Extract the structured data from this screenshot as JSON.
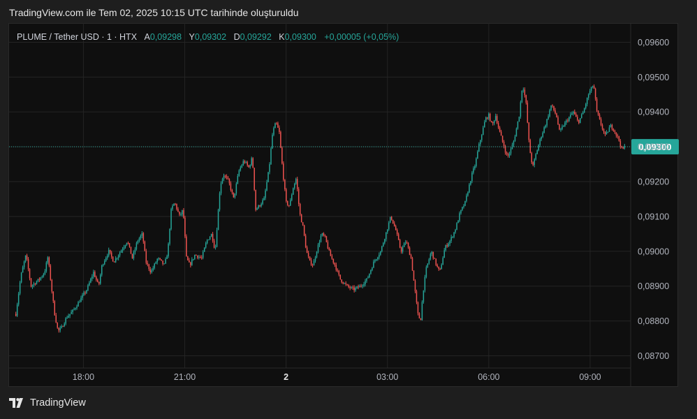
{
  "header": {
    "title": "TradingView.com ile Tem 02, 2025 10:15 UTC tarihinde oluşturuldu"
  },
  "legend": {
    "symbol": "PLUME / Tether USD · 1 · HTX",
    "open_label": "A",
    "open": "0,09298",
    "high_label": "Y",
    "high": "0,09302",
    "low_label": "D",
    "low": "0,09292",
    "close_label": "K",
    "close": "0,09300",
    "change": "+0,00005 (+0,05%)"
  },
  "footer": {
    "brand": "TradingView"
  },
  "colors": {
    "up": "#26a69a",
    "down": "#ef5350",
    "grid": "#242424",
    "axis_text": "#b2b5be",
    "price_tag": "#26a69a",
    "background": "#0f0f0f"
  },
  "chart_data": {
    "type": "candlestick",
    "interval": "1 minute",
    "symbol": "PLUME / Tether USD",
    "exchange": "HTX",
    "y_ticks": [
      "0,09600",
      "0,09500",
      "0,09400",
      "0,09300",
      "0,09200",
      "0,09100",
      "0,09000",
      "0,08900",
      "0,08800",
      "0,08700"
    ],
    "y_tick_values": [
      0.096,
      0.095,
      0.094,
      0.093,
      0.092,
      0.091,
      0.09,
      0.089,
      0.088,
      0.087
    ],
    "x_ticks": [
      "18:00",
      "21:00",
      "2",
      "03:00",
      "06:00",
      "09:00"
    ],
    "x_tick_hours": [
      2.0,
      5.0,
      8.0,
      11.0,
      14.0,
      17.0
    ],
    "ylim": [
      0.08665,
      0.09655
    ],
    "xlim_hours": [
      -0.2,
      18.2
    ],
    "last_price": "0,09300",
    "last_price_value": 0.093,
    "grid": true,
    "close_path": [
      [
        0.0,
        0.0882
      ],
      [
        0.15,
        0.0893
      ],
      [
        0.3,
        0.0899
      ],
      [
        0.45,
        0.089
      ],
      [
        0.7,
        0.0892
      ],
      [
        0.85,
        0.0894
      ],
      [
        0.95,
        0.08985
      ],
      [
        1.05,
        0.089
      ],
      [
        1.15,
        0.0882
      ],
      [
        1.25,
        0.0877
      ],
      [
        1.35,
        0.0878
      ],
      [
        1.5,
        0.0881
      ],
      [
        1.7,
        0.0883
      ],
      [
        1.9,
        0.0886
      ],
      [
        2.1,
        0.0889
      ],
      [
        2.3,
        0.0894
      ],
      [
        2.45,
        0.089
      ],
      [
        2.55,
        0.0896
      ],
      [
        2.65,
        0.0898
      ],
      [
        2.75,
        0.09
      ],
      [
        2.9,
        0.0897
      ],
      [
        3.1,
        0.09
      ],
      [
        3.3,
        0.0903
      ],
      [
        3.45,
        0.0898
      ],
      [
        3.6,
        0.0903
      ],
      [
        3.75,
        0.0905
      ],
      [
        3.85,
        0.0897
      ],
      [
        4.0,
        0.0894
      ],
      [
        4.2,
        0.0898
      ],
      [
        4.4,
        0.0896
      ],
      [
        4.5,
        0.09
      ],
      [
        4.6,
        0.0912
      ],
      [
        4.7,
        0.0914
      ],
      [
        4.85,
        0.091
      ],
      [
        4.95,
        0.0912
      ],
      [
        5.05,
        0.0898
      ],
      [
        5.15,
        0.0896
      ],
      [
        5.3,
        0.0899
      ],
      [
        5.5,
        0.0898
      ],
      [
        5.65,
        0.0903
      ],
      [
        5.8,
        0.0905
      ],
      [
        5.9,
        0.09
      ],
      [
        6.05,
        0.0919
      ],
      [
        6.15,
        0.0922
      ],
      [
        6.3,
        0.092
      ],
      [
        6.45,
        0.0915
      ],
      [
        6.6,
        0.0923
      ],
      [
        6.75,
        0.0926
      ],
      [
        6.9,
        0.0924
      ],
      [
        7.0,
        0.0927
      ],
      [
        7.1,
        0.0912
      ],
      [
        7.2,
        0.0913
      ],
      [
        7.35,
        0.0915
      ],
      [
        7.5,
        0.0924
      ],
      [
        7.6,
        0.0934
      ],
      [
        7.7,
        0.0937
      ],
      [
        7.8,
        0.0934
      ],
      [
        7.9,
        0.0923
      ],
      [
        8.0,
        0.0914
      ],
      [
        8.1,
        0.0913
      ],
      [
        8.2,
        0.0918
      ],
      [
        8.3,
        0.0921
      ],
      [
        8.4,
        0.0911
      ],
      [
        8.5,
        0.0907
      ],
      [
        8.6,
        0.09
      ],
      [
        8.7,
        0.0897
      ],
      [
        8.8,
        0.0896
      ],
      [
        8.9,
        0.09
      ],
      [
        9.05,
        0.0905
      ],
      [
        9.15,
        0.0904
      ],
      [
        9.3,
        0.0899
      ],
      [
        9.45,
        0.0896
      ],
      [
        9.6,
        0.0892
      ],
      [
        9.8,
        0.089
      ],
      [
        10.0,
        0.0889
      ],
      [
        10.2,
        0.089
      ],
      [
        10.4,
        0.0892
      ],
      [
        10.6,
        0.0897
      ],
      [
        10.8,
        0.09
      ],
      [
        10.95,
        0.0905
      ],
      [
        11.1,
        0.091
      ],
      [
        11.25,
        0.0906
      ],
      [
        11.4,
        0.09
      ],
      [
        11.55,
        0.0903
      ],
      [
        11.7,
        0.0898
      ],
      [
        11.8,
        0.089
      ],
      [
        11.9,
        0.0882
      ],
      [
        11.98,
        0.088
      ],
      [
        12.05,
        0.0888
      ],
      [
        12.15,
        0.0895
      ],
      [
        12.3,
        0.09
      ],
      [
        12.45,
        0.0896
      ],
      [
        12.55,
        0.0894
      ],
      [
        12.7,
        0.0901
      ],
      [
        12.85,
        0.0903
      ],
      [
        13.0,
        0.0906
      ],
      [
        13.15,
        0.0911
      ],
      [
        13.3,
        0.0914
      ],
      [
        13.4,
        0.0918
      ],
      [
        13.5,
        0.0922
      ],
      [
        13.6,
        0.0925
      ],
      [
        13.7,
        0.093
      ],
      [
        13.8,
        0.0934
      ],
      [
        13.9,
        0.0938
      ],
      [
        14.0,
        0.0939
      ],
      [
        14.1,
        0.0936
      ],
      [
        14.2,
        0.0939
      ],
      [
        14.3,
        0.0935
      ],
      [
        14.45,
        0.093
      ],
      [
        14.55,
        0.0927
      ],
      [
        14.65,
        0.0929
      ],
      [
        14.75,
        0.0932
      ],
      [
        14.9,
        0.0939
      ],
      [
        15.0,
        0.0948
      ],
      [
        15.1,
        0.0943
      ],
      [
        15.2,
        0.093
      ],
      [
        15.3,
        0.0924
      ],
      [
        15.4,
        0.0928
      ],
      [
        15.55,
        0.0933
      ],
      [
        15.7,
        0.0937
      ],
      [
        15.85,
        0.0942
      ],
      [
        16.0,
        0.0939
      ],
      [
        16.1,
        0.0934
      ],
      [
        16.2,
        0.0936
      ],
      [
        16.35,
        0.0938
      ],
      [
        16.5,
        0.094
      ],
      [
        16.65,
        0.0937
      ],
      [
        16.8,
        0.094
      ],
      [
        16.95,
        0.0945
      ],
      [
        17.1,
        0.0948
      ],
      [
        17.2,
        0.094
      ],
      [
        17.3,
        0.0937
      ],
      [
        17.45,
        0.0933
      ],
      [
        17.6,
        0.0936
      ],
      [
        17.7,
        0.0935
      ],
      [
        17.85,
        0.0932
      ],
      [
        17.95,
        0.0929
      ],
      [
        18.02,
        0.093
      ]
    ]
  }
}
